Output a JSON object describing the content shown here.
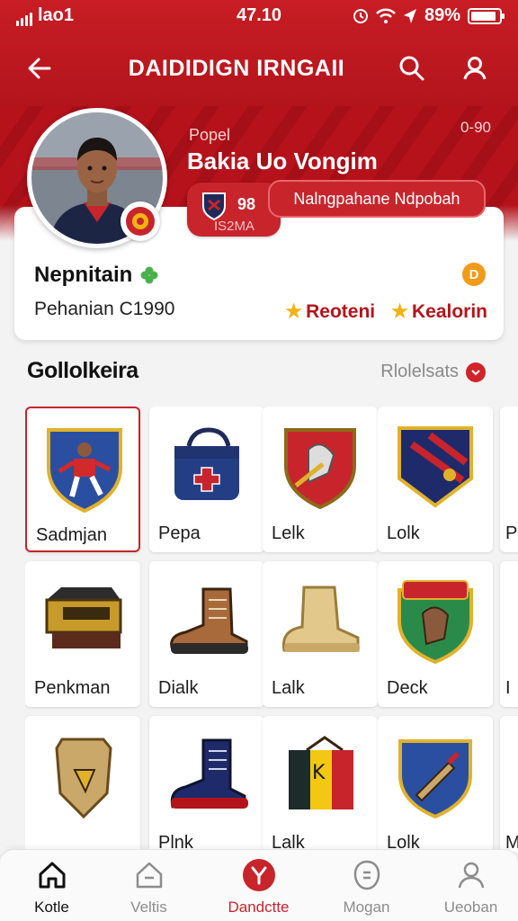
{
  "status_bar": {
    "carrier": "lao1",
    "time": "47.10",
    "battery": "89%",
    "battery_level": 0.89
  },
  "header": {
    "title": "DAIDIDIGN IRNGAII"
  },
  "profile": {
    "role": "Popel",
    "name": "Bakia Uo Vongim",
    "count": "0-90",
    "club_chip_number": "98",
    "club_chip_sub": "IS2MA",
    "follow_label": "Nalngpahane Ndpobah",
    "card_name": "Nepnitain",
    "card_sub": "Pehanian  C1990",
    "card_dot": "D",
    "tags": [
      "Reoteni",
      "Kealorin"
    ]
  },
  "collection": {
    "title": "Gollolkeira",
    "link": "Rlolelsats",
    "items": [
      {
        "label": "Sadmjan",
        "icon": "player-shield-icon"
      },
      {
        "label": "Pepa",
        "icon": "bag-icon"
      },
      {
        "label": "Lelk",
        "icon": "crest-shield-icon"
      },
      {
        "label": "Lolk",
        "icon": "banner-badge-icon"
      },
      {
        "label": "P",
        "icon": "item-icon"
      },
      {
        "label": "Penkman",
        "icon": "chest-icon"
      },
      {
        "label": "Dialk",
        "icon": "boot-icon"
      },
      {
        "label": "Lalk",
        "icon": "beige-boot-icon"
      },
      {
        "label": "Deck",
        "icon": "horse-crest-icon"
      },
      {
        "label": "I",
        "icon": "item-icon"
      },
      {
        "label": "",
        "icon": "shin-guard-icon"
      },
      {
        "label": "Plnk",
        "icon": "navy-boot-icon"
      },
      {
        "label": "Lalk",
        "icon": "flag-box-icon"
      },
      {
        "label": "Lolk",
        "icon": "sword-shield-icon"
      },
      {
        "label": "M",
        "icon": "item-icon"
      }
    ]
  },
  "bottom_nav": [
    {
      "label": "Kotle",
      "icon": "home-icon"
    },
    {
      "label": "Veltis",
      "icon": "house-outline-icon"
    },
    {
      "label": "Dandctte",
      "icon": "trophy-icon"
    },
    {
      "label": "Mogan",
      "icon": "shield-outline-icon"
    },
    {
      "label": "Ueoban",
      "icon": "profile-icon"
    }
  ],
  "colors": {
    "brand_red": "#c8242c",
    "dark_red": "#b3141c",
    "star_gold": "#f2b312",
    "badge_orange": "#f29a1a"
  }
}
